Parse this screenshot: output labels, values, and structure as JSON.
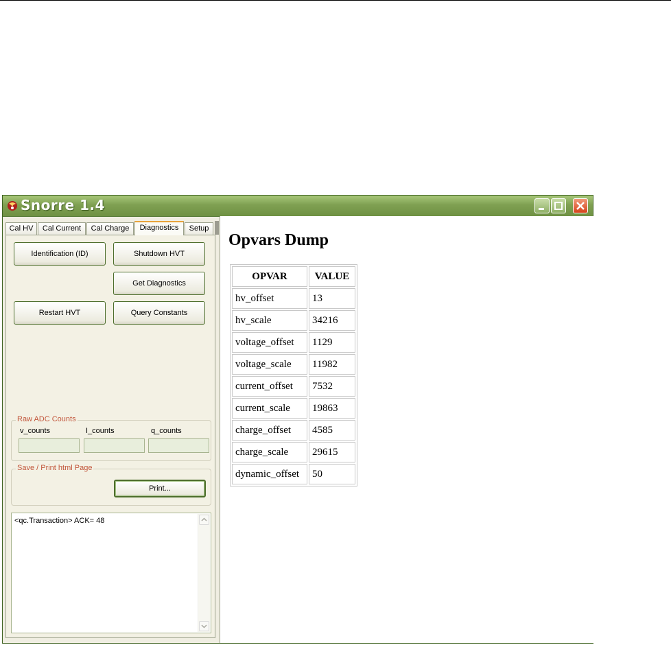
{
  "window": {
    "title": "Snorre 1.4",
    "accent": "#e8a33a",
    "titlebar_color": "#7fa052"
  },
  "tabs": [
    {
      "label": "Cal HV"
    },
    {
      "label": "Cal Current"
    },
    {
      "label": "Cal Charge"
    },
    {
      "label": "Diagnostics",
      "active": true
    },
    {
      "label": "Setup"
    }
  ],
  "buttons": {
    "identification": "Identification (ID)",
    "shutdown": "Shutdown HVT",
    "get_diagnostics": "Get Diagnostics",
    "restart": "Restart HVT",
    "query_constants": "Query Constants",
    "print": "Print..."
  },
  "raw_adc": {
    "group_label": "Raw ADC Counts",
    "v_counts_label": "v_counts",
    "i_counts_label": "I_counts",
    "q_counts_label": "q_counts",
    "v_counts_value": "",
    "i_counts_value": "",
    "q_counts_value": ""
  },
  "save_print": {
    "group_label": "Save / Print html Page"
  },
  "log": {
    "text": "<qc.Transaction> ACK= 48"
  },
  "report": {
    "title": "Opvars Dump",
    "columns": [
      "OPVAR",
      "VALUE"
    ],
    "rows": [
      [
        "hv_offset",
        "13"
      ],
      [
        "hv_scale",
        "34216"
      ],
      [
        "voltage_offset",
        "1129"
      ],
      [
        "voltage_scale",
        "11982"
      ],
      [
        "current_offset",
        "7532"
      ],
      [
        "current_scale",
        "19863"
      ],
      [
        "charge_offset",
        "4585"
      ],
      [
        "charge_scale",
        "29615"
      ],
      [
        "dynamic_offset",
        "50"
      ]
    ]
  }
}
